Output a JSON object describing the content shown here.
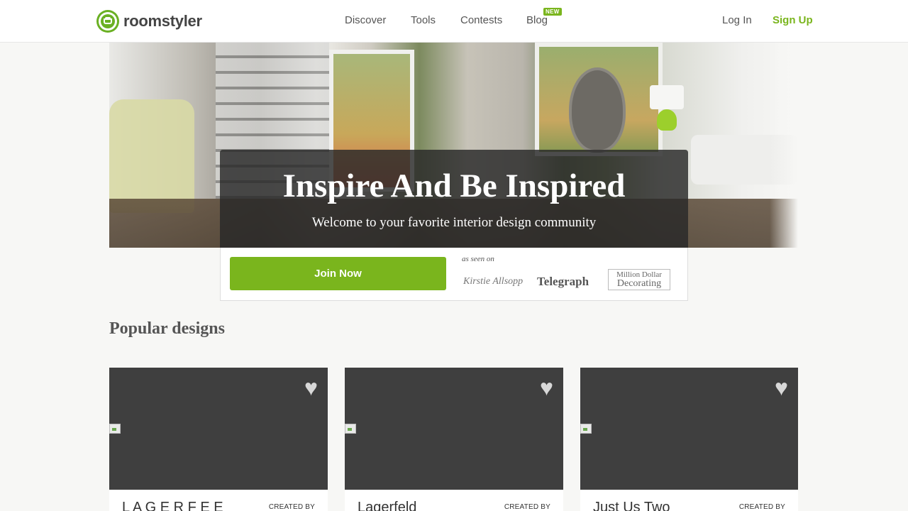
{
  "brand": {
    "name": "roomstyler"
  },
  "nav": {
    "items": [
      {
        "label": "Discover"
      },
      {
        "label": "Tools"
      },
      {
        "label": "Contests"
      },
      {
        "label": "Blog",
        "badge": "NEW"
      }
    ],
    "login": "Log In",
    "signup": "Sign Up"
  },
  "hero": {
    "title": "Inspire And Be Inspired",
    "subtitle": "Welcome to your favorite interior design community",
    "cta": "Join Now",
    "as_seen_on": "as seen on",
    "press": [
      "Kirstie Allsopp",
      "Telegraph",
      "Million Dollar",
      "Decorating"
    ]
  },
  "popular": {
    "title": "Popular designs",
    "created_by_label": "CREATED BY",
    "cards": [
      {
        "name": "L A G E R F E E"
      },
      {
        "name": "Lagerfeld"
      },
      {
        "name": "Just Us Two"
      }
    ]
  },
  "colors": {
    "accent": "#7ab51d",
    "card_bg": "#3f3f3f",
    "page_bg": "#f7f7f5"
  }
}
